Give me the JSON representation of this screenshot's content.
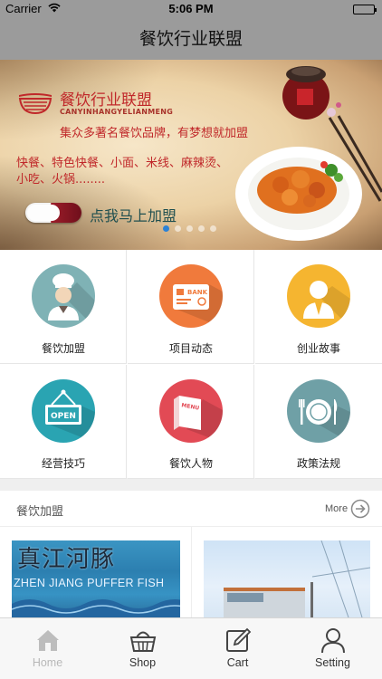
{
  "status_bar": {
    "carrier": "Carrier",
    "time": "5:06 PM"
  },
  "nav": {
    "title": "餐饮行业联盟"
  },
  "banner": {
    "brand": "餐饮行业联盟",
    "brand_pinyin": "CANYINHANGYELIANMENG",
    "slogan": "集众多著名餐饮品牌，有梦想就加盟",
    "menu_line1": "快餐、特色快餐、小面、米线、麻辣烫、",
    "menu_line2": "小吃、火锅........",
    "join_label": "点我马上加盟",
    "pager_count": 5,
    "pager_active": 0
  },
  "categories": [
    {
      "label": "餐饮加盟",
      "icon": "chef-icon",
      "color": "#7fb2b5"
    },
    {
      "label": "项目动态",
      "icon": "bank-card-icon",
      "color": "#f07a3c"
    },
    {
      "label": "创业故事",
      "icon": "businessman-icon",
      "color": "#f5b530"
    },
    {
      "label": "经营技巧",
      "icon": "open-sign-icon",
      "color": "#2aa4b2"
    },
    {
      "label": "餐饮人物",
      "icon": "menu-book-icon",
      "color": "#e24a55"
    },
    {
      "label": "政策法规",
      "icon": "plate-cutlery-icon",
      "color": "#6fa0a6"
    }
  ],
  "section": {
    "title": "餐饮加盟",
    "more_label": "More",
    "cards": [
      {
        "title_cn": "真江河豚",
        "title_en": "ZHEN JIANG PUFFER FISH"
      },
      {
        "title_cn": "",
        "title_en": ""
      }
    ]
  },
  "tabs": [
    {
      "label": "Home",
      "icon": "home-icon",
      "active": false
    },
    {
      "label": "Shop",
      "icon": "basket-icon",
      "active": true
    },
    {
      "label": "Cart",
      "icon": "edit-icon",
      "active": true
    },
    {
      "label": "Setting",
      "icon": "person-icon",
      "active": true
    }
  ]
}
